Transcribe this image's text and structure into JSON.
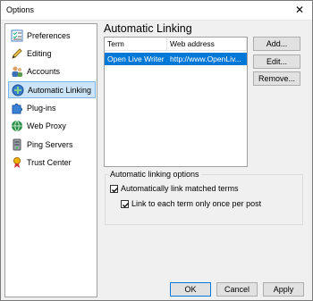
{
  "window": {
    "title": "Options"
  },
  "sidebar": {
    "items": [
      {
        "label": "Preferences",
        "icon": "checklist-icon"
      },
      {
        "label": "Editing",
        "icon": "pencil-icon"
      },
      {
        "label": "Accounts",
        "icon": "users-icon"
      },
      {
        "label": "Automatic Linking",
        "icon": "link-icon",
        "selected": true
      },
      {
        "label": "Plug-ins",
        "icon": "puzzle-icon"
      },
      {
        "label": "Web Proxy",
        "icon": "globe-icon"
      },
      {
        "label": "Ping Servers",
        "icon": "server-icon"
      },
      {
        "label": "Trust Center",
        "icon": "trust-center-icon"
      }
    ]
  },
  "main": {
    "title": "Automatic Linking",
    "table": {
      "headers": [
        "Term",
        "Web address"
      ],
      "rows": [
        [
          "Open Live Writer ...",
          "http://www.OpenLiv..."
        ]
      ]
    },
    "buttons": {
      "add": "Add...",
      "edit": "Edit...",
      "remove": "Remove..."
    },
    "options_group": {
      "title": "Automatic linking options",
      "auto_link_label": "Automatically link matched terms",
      "auto_link_checked": true,
      "once_per_post_label": "Link to each term only once per post",
      "once_per_post_checked": true
    }
  },
  "footer": {
    "ok": "OK",
    "cancel": "Cancel",
    "apply": "Apply"
  },
  "colors": {
    "selection": "#0078d7",
    "nav_selected": "#cce4f7"
  }
}
